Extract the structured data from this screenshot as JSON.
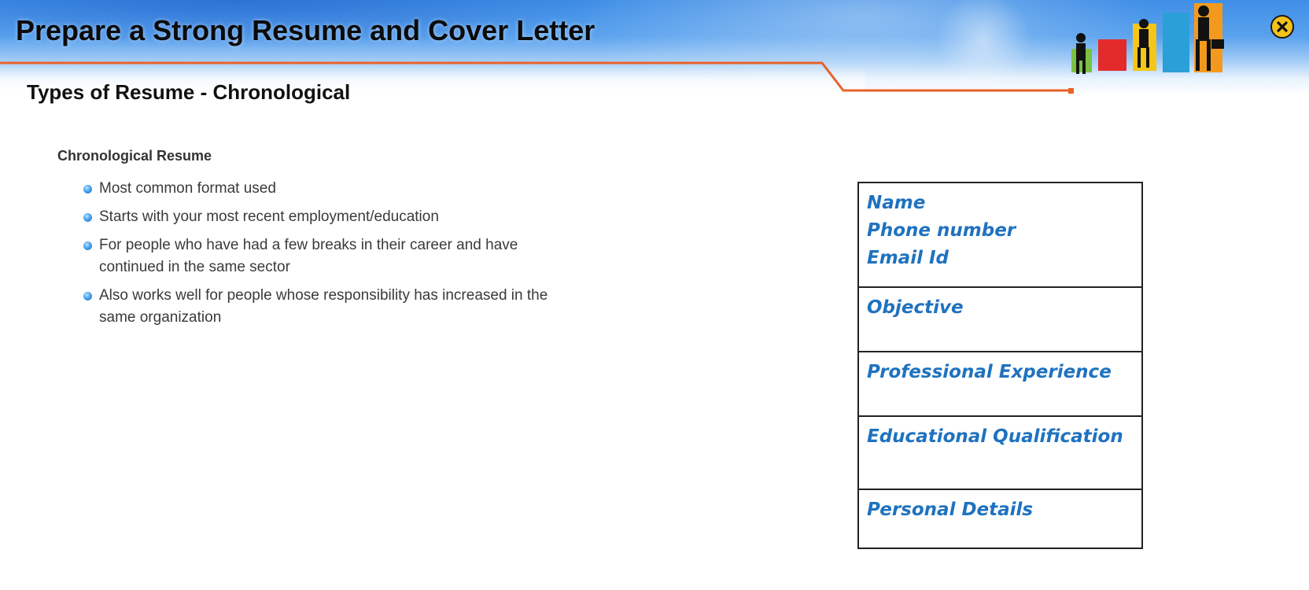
{
  "app": {
    "title": "Prepare a Strong Resume and Cover Letter",
    "close_icon": "close-icon"
  },
  "slide": {
    "title": "Types of Resume - Chronological"
  },
  "content": {
    "heading": "Chronological Resume",
    "bullets": [
      "Most common format used",
      "Starts with your most recent employment/education",
      "For people who have had a few breaks in their career and have continued in the same sector",
      "Also works well for people whose responsibility has increased in the same organization"
    ]
  },
  "resume": {
    "contact": [
      "Name",
      "Phone number",
      "Email Id"
    ],
    "objective": "Objective",
    "experience": "Professional Experience",
    "education": "Educational Qualification",
    "personal": "Personal Details"
  },
  "colors": {
    "accent_blue": "#1f72bf",
    "banner_blue": "#3f8ee6",
    "banner_orange": "#e8622a",
    "close_yellow": "#f3c21a"
  }
}
